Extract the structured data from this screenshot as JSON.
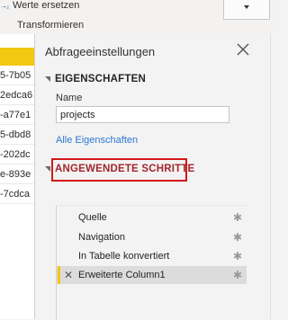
{
  "ribbon": {
    "replace_values_label": "Werte ersetzen",
    "replace_icon_text": "→₂",
    "group_label": "Transformieren"
  },
  "query_list": {
    "items": [
      "5-7b05",
      "2edca6",
      "-a77e1",
      "5-dbd8",
      "-202dc",
      "e-893e",
      "-7cdca"
    ],
    "accent_color": "#f2c811"
  },
  "settings": {
    "title": "Abfrageeinstellungen",
    "close_icon": "close-icon",
    "properties": {
      "heading": "EIGENSCHAFTEN",
      "name_label": "Name",
      "name_value": "projects",
      "all_properties_link": "Alle Eigenschaften"
    },
    "applied_steps": {
      "heading": "ANGEWENDETE SCHRITTE",
      "highlight_color": "#d41919",
      "steps": [
        {
          "label": "Quelle",
          "icon": "gear-icon"
        },
        {
          "label": "Navigation",
          "icon": "gear-icon"
        },
        {
          "label": "In Tabelle konvertiert",
          "icon": "gear-icon"
        },
        {
          "label": "Erweiterte Column1",
          "icon": "gear-icon",
          "selected": true
        }
      ]
    }
  }
}
